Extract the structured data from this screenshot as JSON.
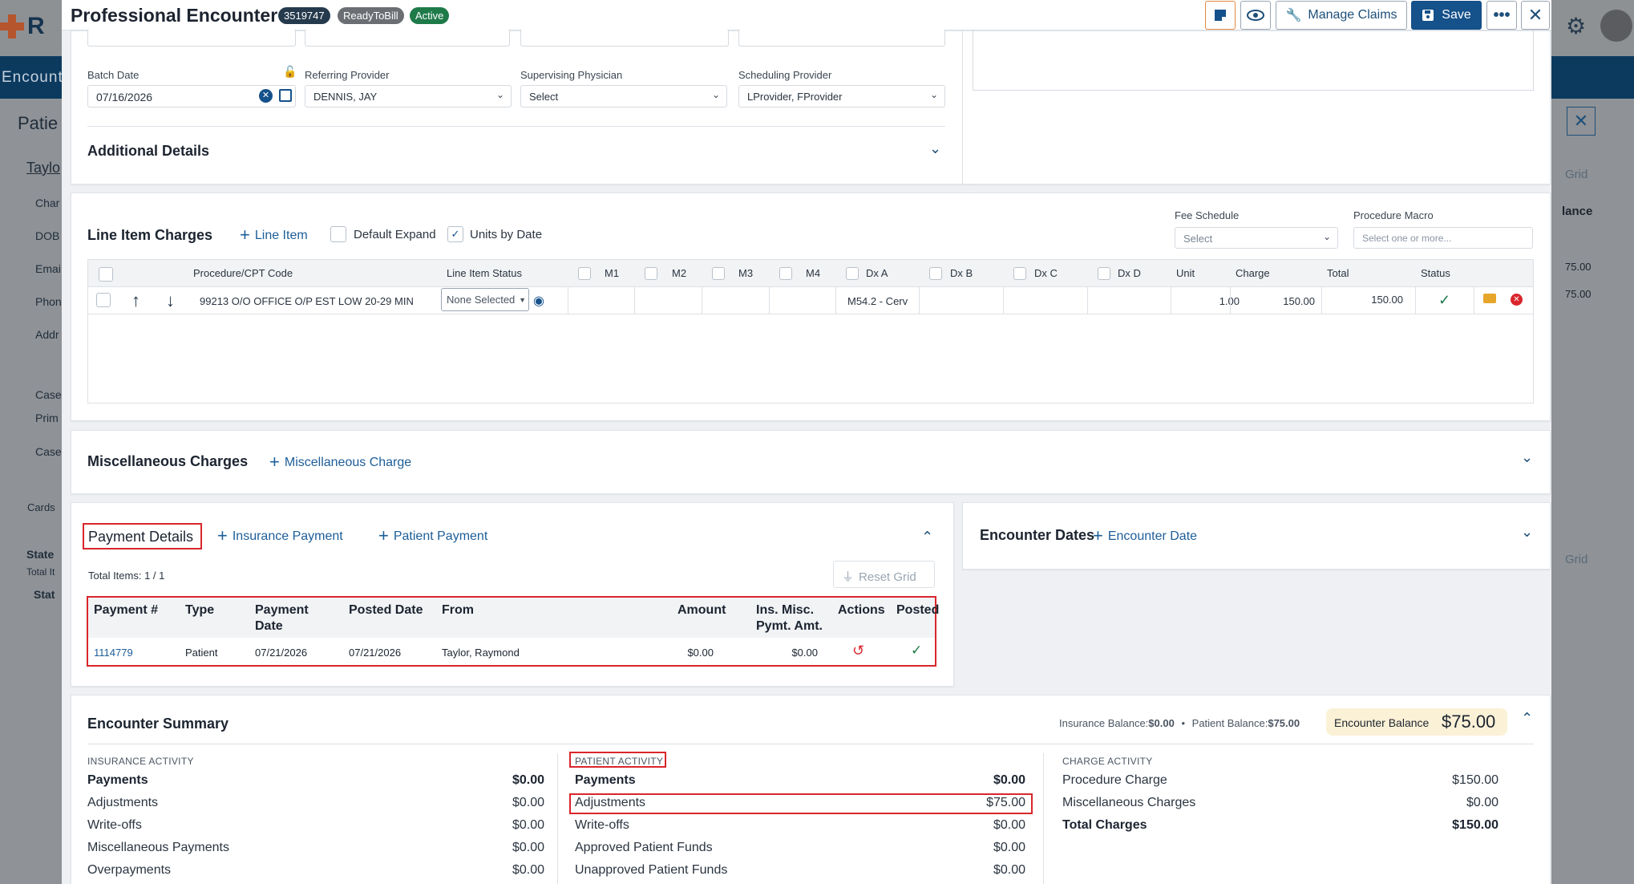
{
  "modal": {
    "title": "Professional Encounter",
    "encounter_id": "3519747",
    "status_badges": [
      "ReadyToBill",
      "Active"
    ],
    "actions": {
      "manage_claims": "Manage Claims",
      "save": "Save"
    }
  },
  "background": {
    "nav_label": "Encount",
    "page_title": "Patie",
    "patient_link": "Taylo",
    "side_labels": [
      "Char",
      "DOB",
      "Emai",
      "Phon",
      "Addr",
      "Case",
      "Prim",
      "Case"
    ],
    "cards_label": "Cards",
    "state_label": "State",
    "total_label": "Total It",
    "state_col": "Stat",
    "right_labels": [
      "Grid",
      "lance",
      "75.00",
      "75.00",
      "Grid"
    ]
  },
  "providers": {
    "batch_date_label": "Batch Date",
    "batch_date_value": "07/16/2026",
    "referring_label": "Referring Provider",
    "referring_value": "DENNIS, JAY",
    "supervising_label": "Supervising Physician",
    "supervising_value": "Select",
    "scheduling_label": "Scheduling Provider",
    "scheduling_value": "LProvider, FProvider",
    "additional_details": "Additional Details"
  },
  "line_items": {
    "title": "Line Item Charges",
    "add_label": "Line Item",
    "default_expand": "Default Expand",
    "units_by_date": "Units by Date",
    "fee_schedule_label": "Fee Schedule",
    "fee_schedule_value": "Select",
    "procedure_macro_label": "Procedure Macro",
    "procedure_macro_placeholder": "Select one or more...",
    "columns": [
      "Procedure/CPT Code",
      "Line Item Status",
      "M1",
      "M2",
      "M3",
      "M4",
      "Dx A",
      "Dx B",
      "Dx C",
      "Dx D",
      "Unit",
      "Charge",
      "Total",
      "Status"
    ],
    "row": {
      "code": "99213 O/O OFFICE O/P EST LOW 20-29 MIN",
      "status": "None Selected",
      "dx_a": "M54.2 - Cerv",
      "unit": "1.00",
      "charge": "150.00",
      "total": "150.00"
    }
  },
  "misc": {
    "title": "Miscellaneous Charges",
    "add_label": "Miscellaneous Charge"
  },
  "payments": {
    "title": "Payment Details",
    "add_insurance": "Insurance Payment",
    "add_patient": "Patient Payment",
    "total_items": "Total Items: 1 / 1",
    "reset_grid": "Reset Grid",
    "columns": {
      "number": "Payment #",
      "type": "Type",
      "payment_date": "Payment Date",
      "posted_date": "Posted Date",
      "from": "From",
      "amount": "Amount",
      "ins_misc": "Ins. Misc. Pymt. Amt.",
      "actions": "Actions",
      "posted": "Posted"
    },
    "rows": [
      {
        "number": "1114779",
        "type": "Patient",
        "payment_date": "07/21/2026",
        "posted_date": "07/21/2026",
        "from": "Taylor, Raymond",
        "amount": "$0.00",
        "ins_misc": "$0.00"
      }
    ]
  },
  "encounter_dates": {
    "title": "Encounter Dates",
    "add_label": "Encounter Date"
  },
  "summary": {
    "title": "Encounter Summary",
    "insurance_balance_label": "Insurance Balance:",
    "insurance_balance": "$0.00",
    "patient_balance_label": "Patient Balance:",
    "patient_balance": "$75.00",
    "encounter_balance_label": "Encounter Balance",
    "encounter_balance": "$75.00",
    "insurance": {
      "title": "INSURANCE ACTIVITY",
      "rows": [
        {
          "label": "Payments",
          "value": "$0.00"
        },
        {
          "label": "Adjustments",
          "value": "$0.00"
        },
        {
          "label": "Write-offs",
          "value": "$0.00"
        },
        {
          "label": "Miscellaneous Payments",
          "value": "$0.00"
        },
        {
          "label": "Overpayments",
          "value": "$0.00"
        }
      ]
    },
    "patient": {
      "title": "PATIENT ACTIVITY",
      "rows": [
        {
          "label": "Payments",
          "value": "$0.00"
        },
        {
          "label": "Adjustments",
          "value": "$75.00"
        },
        {
          "label": "Write-offs",
          "value": "$0.00"
        },
        {
          "label": "Approved Patient Funds",
          "value": "$0.00"
        },
        {
          "label": "Unapproved Patient Funds",
          "value": "$0.00"
        }
      ]
    },
    "charges": {
      "title": "CHARGE ACTIVITY",
      "rows": [
        {
          "label": "Procedure Charge",
          "value": "$150.00"
        },
        {
          "label": "Miscellaneous Charges",
          "value": "$0.00"
        },
        {
          "label": "Total Charges",
          "value": "$150.00"
        }
      ]
    }
  },
  "colors": {
    "primary": "#15518a",
    "link": "#1d5e98",
    "highlight": "#d9262c",
    "balance_pill": "#fbf1d6"
  }
}
